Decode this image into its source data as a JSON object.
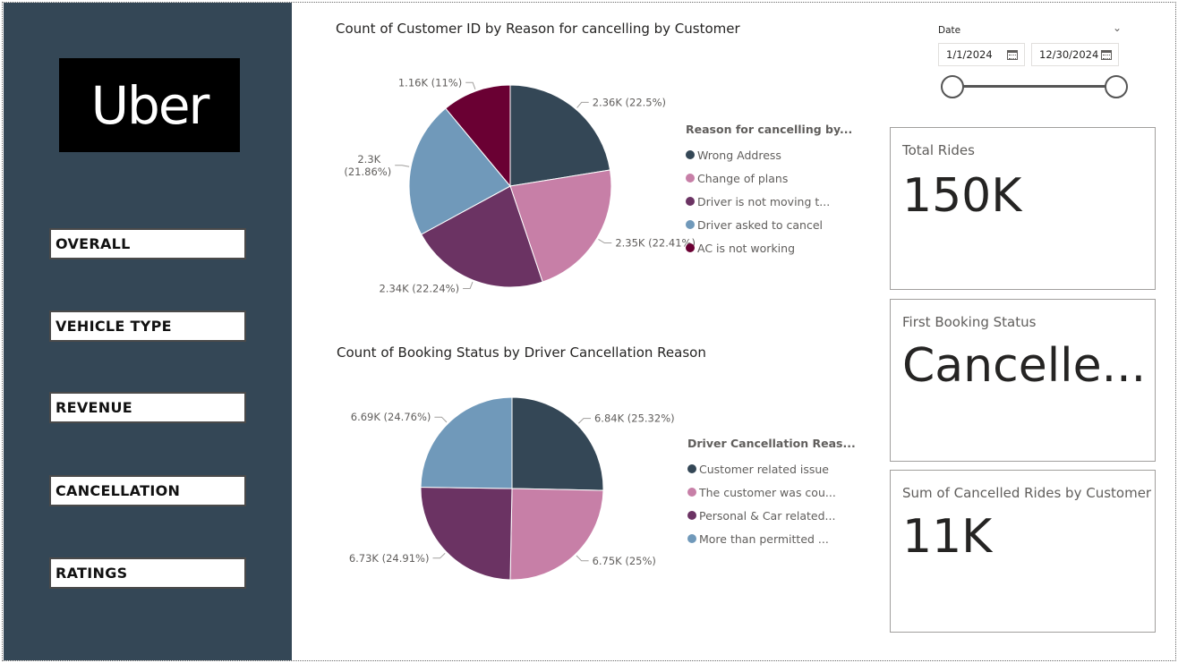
{
  "sidebar": {
    "logo_text": "Uber",
    "nav": [
      {
        "label": "OVERALL"
      },
      {
        "label": "VEHICLE TYPE"
      },
      {
        "label": "REVENUE"
      },
      {
        "label": "CANCELLATION"
      },
      {
        "label": "RATINGS"
      }
    ]
  },
  "date_slicer": {
    "title": "Date",
    "start": "1/1/2024",
    "end": "12/30/2024",
    "range_fraction": [
      0,
      1
    ]
  },
  "cards": [
    {
      "title": "Total Rides",
      "value": "150K"
    },
    {
      "title": "First Booking Status",
      "value": "Cancelle..."
    },
    {
      "title": "Sum of Cancelled Rides by Customer",
      "value": "11K"
    }
  ],
  "colors": {
    "sidebar_bg": "#344756",
    "slice_1": "#344756",
    "slice_2": "#C77FA7",
    "slice_3": "#6B3363",
    "slice_4": "#7099BA",
    "slice_5": "#6A0033"
  },
  "chart_data": [
    {
      "type": "pie",
      "title": "Count of Customer ID by Reason for cancelling by Customer",
      "legend_title": "Reason for cancelling by...",
      "legend_position": "right",
      "series": [
        {
          "name": "Wrong Address",
          "legend_label": "Wrong Address",
          "value": 2360,
          "label": "2.36K (22.5%)",
          "color": "#344756"
        },
        {
          "name": "Change of plans",
          "legend_label": "Change of plans",
          "value": 2350,
          "label": "2.35K (22.41%)",
          "color": "#C77FA7"
        },
        {
          "name": "Driver is not moving towards pickup location",
          "legend_label": "Driver is not moving t...",
          "value": 2340,
          "label": "2.34K (22.24%)",
          "color": "#6B3363"
        },
        {
          "name": "Driver asked to cancel",
          "legend_label": "Driver asked to cancel",
          "value": 2300,
          "label": "2.3K (21.86%)",
          "label_line1": "2.3K",
          "label_line2": "(21.86%)",
          "color": "#7099BA"
        },
        {
          "name": "AC is not working",
          "legend_label": "AC is not working",
          "value": 1160,
          "label": "1.16K (11%)",
          "color": "#6A0033"
        }
      ]
    },
    {
      "type": "pie",
      "title": "Count of Booking Status by Driver Cancellation Reason",
      "legend_title": "Driver Cancellation Reas...",
      "legend_position": "right",
      "series": [
        {
          "name": "Customer related issue",
          "legend_label": "Customer related issue",
          "value": 6840,
          "label": "6.84K (25.32%)",
          "color": "#344756"
        },
        {
          "name": "The customer was coughing/sick",
          "legend_label": "The customer was cou...",
          "value": 6750,
          "label": "6.75K (25%)",
          "color": "#C77FA7"
        },
        {
          "name": "Personal & Car related issues",
          "legend_label": "Personal & Car related...",
          "value": 6730,
          "label": "6.73K (24.91%)",
          "color": "#6B3363"
        },
        {
          "name": "More than permitted people in there",
          "legend_label": "More than permitted ...",
          "value": 6690,
          "label": "6.69K (24.76%)",
          "color": "#7099BA"
        }
      ]
    }
  ]
}
